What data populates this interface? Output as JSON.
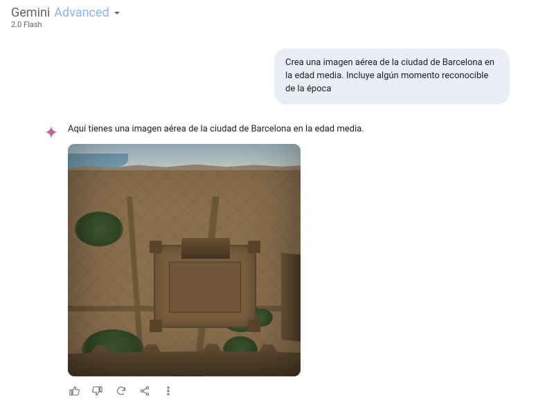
{
  "header": {
    "brand": "Gemini",
    "tier": "Advanced",
    "model": "2.0 Flash"
  },
  "user_message": "Crea una imagen aérea de la ciudad de Barcelona en la edad media. Incluye algún momento reconocible de la época",
  "assistant_text": "Aquí tienes una imagen aérea de la ciudad de Barcelona en la edad media.",
  "image_alt": "Aerial view of medieval walled city with fortress, towers and dense buildings",
  "actions": {
    "like": "Me gusta",
    "dislike": "No me gusta",
    "regenerate": "Regenerar",
    "share": "Compartir",
    "more": "Más opciones"
  }
}
